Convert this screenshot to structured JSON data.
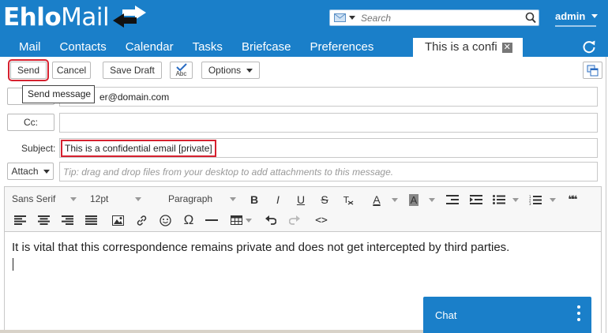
{
  "app": {
    "logo_part1": "Ehlo",
    "logo_part2": "Mail",
    "search_placeholder": "Search",
    "user": "admin"
  },
  "tabs": [
    {
      "label": "Mail"
    },
    {
      "label": "Contacts"
    },
    {
      "label": "Calendar"
    },
    {
      "label": "Tasks"
    },
    {
      "label": "Briefcase"
    },
    {
      "label": "Preferences"
    }
  ],
  "active_tab": {
    "label": "This is a confi",
    "close_glyph": "✕"
  },
  "toolbar": {
    "send": "Send",
    "cancel": "Cancel",
    "save_draft": "Save Draft",
    "spell_label": "Abc",
    "options": "Options"
  },
  "tooltip": "Send message",
  "compose": {
    "to_value": "er@domain.com",
    "cc_label": "Cc:",
    "subject_label": "Subject:",
    "subject_value": "This is a confidential email [private]",
    "attach_label": "Attach",
    "attach_placeholder": "Tip: drag and drop files from your desktop to add attachments to this message."
  },
  "editor": {
    "font_family": "Sans Serif",
    "font_size": "12pt",
    "block_format": "Paragraph",
    "bold": "B",
    "italic": "I",
    "underline": "U",
    "strike": "S",
    "text_color": "A",
    "bg_color": "A",
    "quote": "❝❝",
    "omega": "Ω",
    "code": "<>",
    "body": "It is vital that this correspondence remains private and does not get intercepted by third parties."
  },
  "chat": {
    "label": "Chat"
  },
  "colors": {
    "brand": "#1a7fc9",
    "highlight": "#d6212f"
  }
}
